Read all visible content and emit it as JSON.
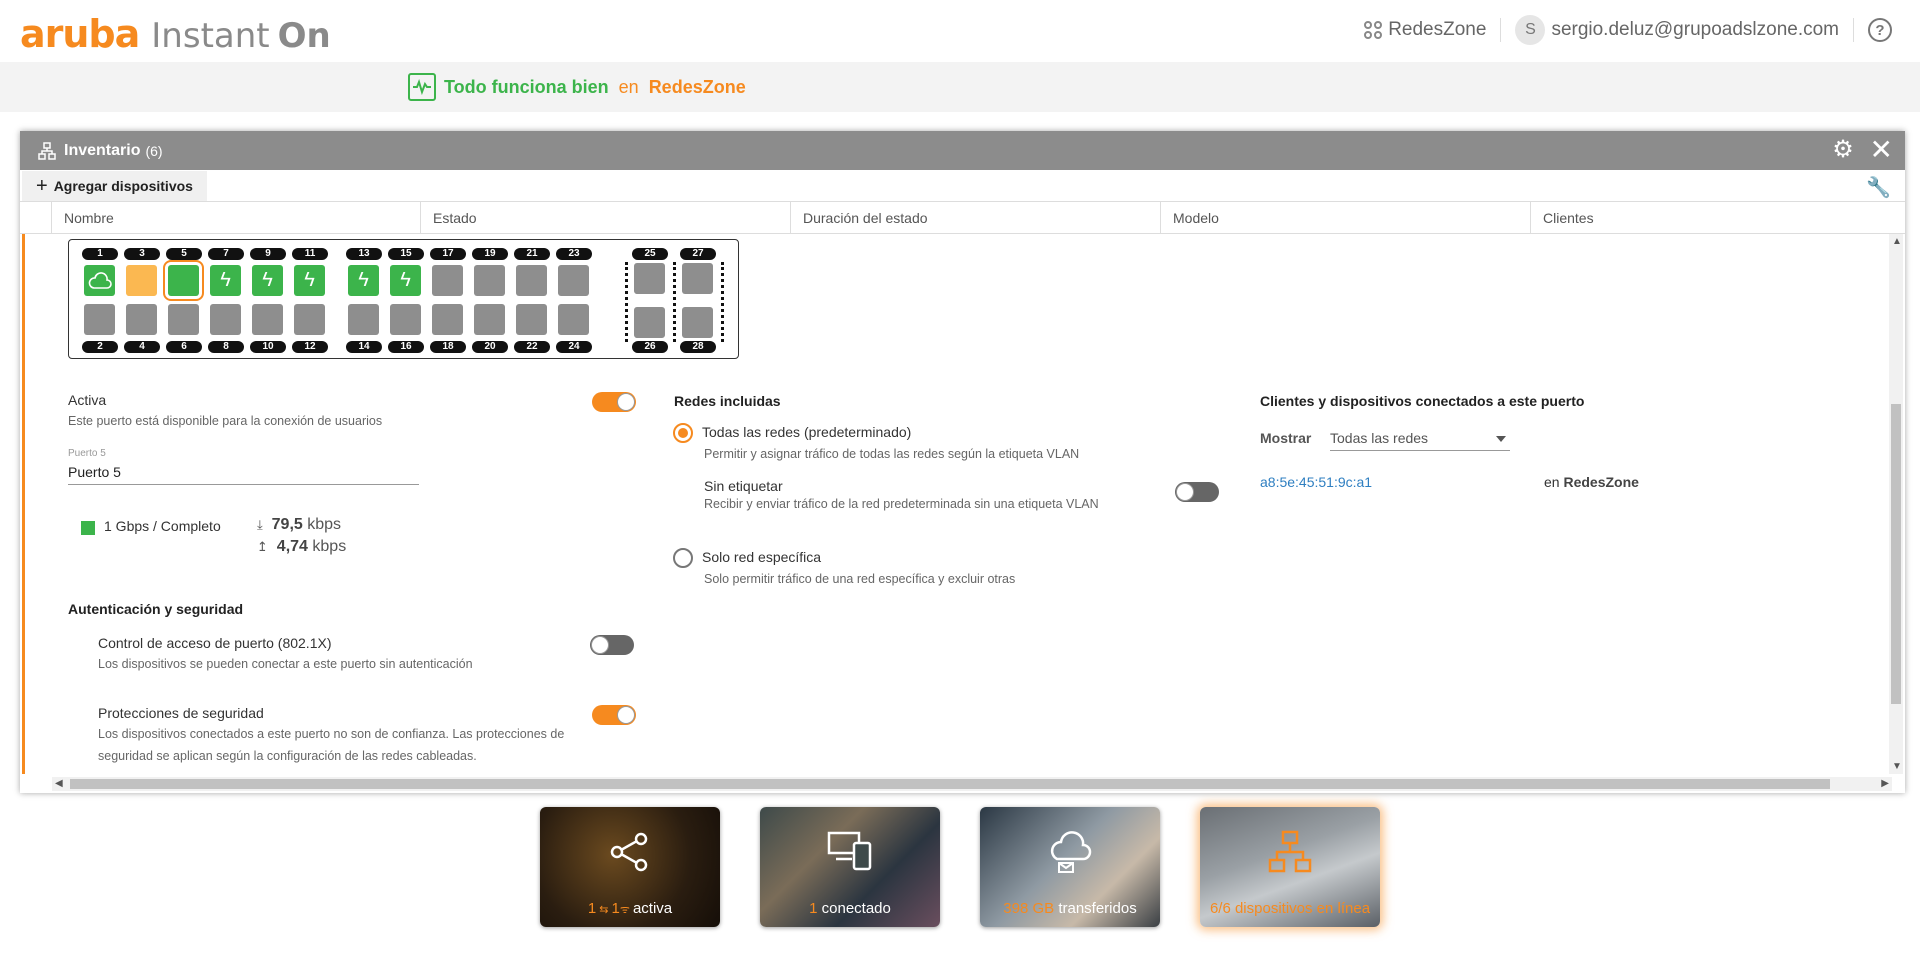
{
  "header": {
    "logo_brand": "aruba",
    "logo_product": "Instant",
    "logo_on": "On",
    "network_name": "RedesZone",
    "user_initial": "S",
    "user_email": "sergio.deluz@grupoadslzone.com",
    "help": "?"
  },
  "status": {
    "message": "Todo funciona bien",
    "connector": "en",
    "network": "RedesZone",
    "color_ok": "#3cb44b",
    "accent": "#f68a1f"
  },
  "inventory": {
    "title": "Inventario",
    "count": "(6)",
    "add_devices": "Agregar dispositivos",
    "columns": [
      "Nombre",
      "Estado",
      "Duración del estado",
      "Modelo",
      "Clientes"
    ]
  },
  "switch": {
    "top_labels": [
      "1",
      "3",
      "5",
      "7",
      "9",
      "11",
      "13",
      "15",
      "17",
      "19",
      "21",
      "23"
    ],
    "bottom_labels": [
      "2",
      "4",
      "6",
      "8",
      "10",
      "12",
      "14",
      "16",
      "18",
      "20",
      "22",
      "24"
    ],
    "sfp_top": [
      "25",
      "27"
    ],
    "sfp_bottom": [
      "26",
      "28"
    ],
    "selected_port": "5"
  },
  "port_settings": {
    "active_label": "Activa",
    "active_desc": "Este puerto está disponible para la conexión de usuarios",
    "name_caption": "Puerto 5",
    "name_value": "Puerto 5",
    "speed": "1 Gbps / Completo",
    "down_value": "79,5",
    "up_value": "4,74",
    "rate_unit": "kbps",
    "auth_title": "Autenticación y seguridad",
    "dot1x_label": "Control de acceso de puerto (802.1X)",
    "dot1x_desc": "Los dispositivos se pueden conectar a este puerto sin autenticación",
    "security_label": "Protecciones de seguridad",
    "security_desc_1": "Los dispositivos conectados a este puerto no son de confianza. Las protecciones de",
    "security_desc_2": "seguridad se aplican según la configuración de las redes cableadas."
  },
  "networks": {
    "title": "Redes incluidas",
    "all_label": "Todas las redes (predeterminado)",
    "all_desc": "Permitir y asignar tráfico de todas las redes según la etiqueta VLAN",
    "untagged_label": "Sin etiquetar",
    "untagged_desc": "Recibir y enviar tráfico de la red predeterminada sin una etiqueta VLAN",
    "specific_label": "Solo red específica",
    "specific_desc": "Solo permitir tráfico de una red específica y excluir otras"
  },
  "clients": {
    "title": "Clientes y dispositivos conectados a este puerto",
    "show_label": "Mostrar",
    "filter_value": "Todas las redes",
    "mac": "a8:5e:45:51:9c:a1",
    "on_label": "en",
    "network": "RedesZone"
  },
  "tiles": [
    {
      "num": "1",
      "num2": "1",
      "text": "activa"
    },
    {
      "num": "1",
      "text": "conectado"
    },
    {
      "num": "398 GB",
      "text": "transferidos"
    },
    {
      "num": "6/6 dispositivos en línea",
      "text": ""
    }
  ]
}
